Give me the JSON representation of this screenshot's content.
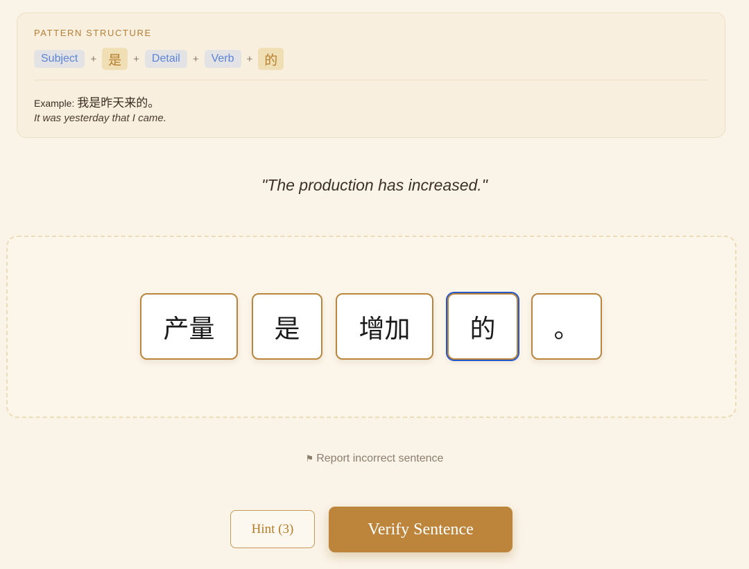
{
  "pattern": {
    "heading": "PATTERN STRUCTURE",
    "parts": [
      {
        "text": "Subject",
        "kind": "role"
      },
      {
        "text": "是",
        "kind": "hanzi"
      },
      {
        "text": "Detail",
        "kind": "role"
      },
      {
        "text": "Verb",
        "kind": "role"
      },
      {
        "text": "的",
        "kind": "hanzi"
      }
    ],
    "separator": "+",
    "example_label": "Example:",
    "example_zh": "我是昨天来的。",
    "example_en": "It was yesterday that I came."
  },
  "prompt": "\"The production has increased.\"",
  "tiles": [
    {
      "text": "产量"
    },
    {
      "text": "是"
    },
    {
      "text": "增加"
    },
    {
      "text": "的",
      "focused": true
    },
    {
      "text": "。"
    }
  ],
  "report": {
    "icon": "flag-icon",
    "glyph": "⚑",
    "label": "Report incorrect sentence"
  },
  "buttons": {
    "hint": "Hint (3)",
    "verify": "Verify Sentence"
  },
  "colors": {
    "background": "#faf3e7",
    "accent": "#bd853b",
    "role_chip_text": "#5b83d6",
    "focus_outline": "#2457c9"
  }
}
